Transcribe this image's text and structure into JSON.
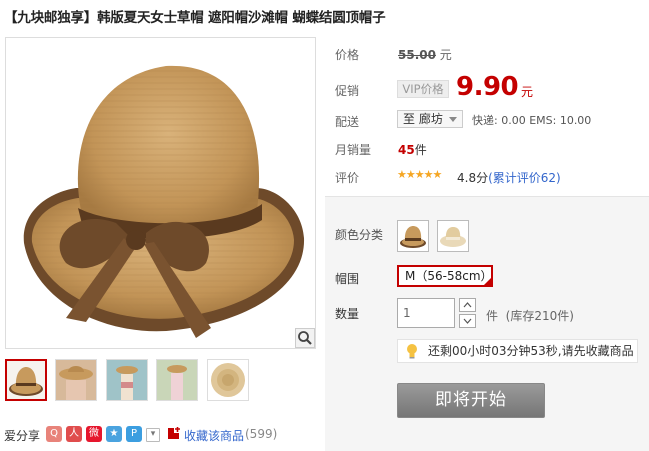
{
  "title": "【九块邮独享】韩版夏天女士草帽 遮阳帽沙滩帽 蝴蝶结圆顶帽子",
  "gallery": {
    "zoom_icon": "magnifier-icon",
    "thumbnails": [
      "hat-front",
      "model-back",
      "model-beach",
      "model-street",
      "hat-top"
    ],
    "selected_index": 0
  },
  "share": {
    "label": "爱分享",
    "icons": [
      "share-q-icon",
      "share-renren-icon",
      "share-weibo-icon",
      "share-qzone-icon",
      "share-p-icon",
      "share-more-icon"
    ],
    "favorite_label": "收藏该商品",
    "favorite_count": "(599)"
  },
  "price": {
    "label": "价格",
    "original": "55.00",
    "unit": "元"
  },
  "promo": {
    "label": "促销",
    "badge": "VIP价格",
    "price": "9.90",
    "unit": "元"
  },
  "shipping": {
    "label": "配送",
    "destination": "至 廊坊",
    "info": "快递: 0.00 EMS: 10.00"
  },
  "sales": {
    "label": "月销量",
    "count": "45",
    "unit": "件"
  },
  "rating": {
    "label": "评价",
    "stars": "★★★★★",
    "score": "4.8分",
    "review_link": "(累计评价62)"
  },
  "options": {
    "color_label": "颜色分类",
    "color_options": [
      "brown-band",
      "beige-band"
    ],
    "size_label": "帽围",
    "size_value": "M（56-58cm）",
    "qty_label": "数量",
    "qty_value": "1",
    "qty_unit": "件",
    "stock": "(库存210件)",
    "timer": "还剩00小时03分钟53秒,请先收藏商品",
    "buy_button": "即将开始"
  },
  "colors": {
    "accent": "#c40000",
    "link": "#3366cc",
    "button": "#888888"
  }
}
